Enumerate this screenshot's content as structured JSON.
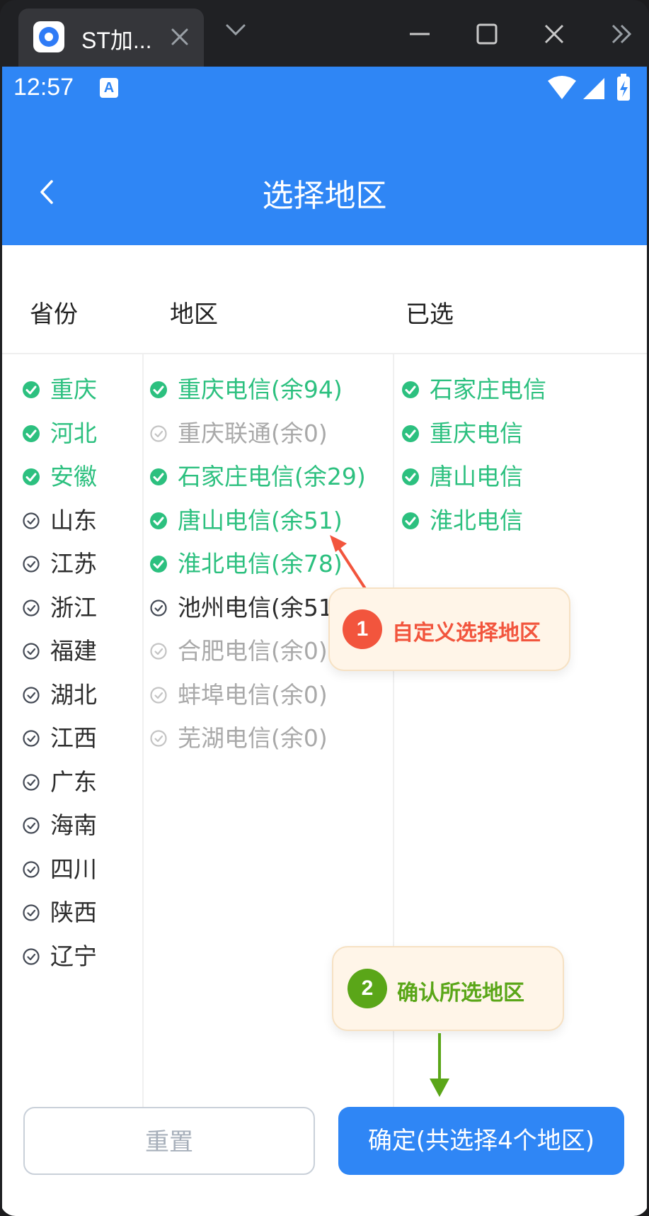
{
  "browser": {
    "tab_title": "ST加...",
    "icons": [
      "app-icon",
      "close-icon",
      "chevron-down-icon",
      "minimize-icon",
      "maximize-icon",
      "close-icon",
      "more-icon"
    ]
  },
  "status_bar": {
    "time": "12:57",
    "indicator": "A"
  },
  "header": {
    "title": "选择地区"
  },
  "columns": {
    "province": "省份",
    "region": "地区",
    "selected": "已选"
  },
  "provinces": [
    {
      "label": "重庆",
      "state": "checked"
    },
    {
      "label": "河北",
      "state": "checked"
    },
    {
      "label": "安徽",
      "state": "checked"
    },
    {
      "label": "山东",
      "state": "available"
    },
    {
      "label": "江苏",
      "state": "available"
    },
    {
      "label": "浙江",
      "state": "available"
    },
    {
      "label": "福建",
      "state": "available"
    },
    {
      "label": "湖北",
      "state": "available"
    },
    {
      "label": "江西",
      "state": "available"
    },
    {
      "label": "广东",
      "state": "available"
    },
    {
      "label": "海南",
      "state": "available"
    },
    {
      "label": "四川",
      "state": "available"
    },
    {
      "label": "陕西",
      "state": "available"
    },
    {
      "label": "辽宁",
      "state": "available"
    }
  ],
  "regions": [
    {
      "label": "重庆电信(余94)",
      "state": "checked"
    },
    {
      "label": "重庆联通(余0)",
      "state": "disabled"
    },
    {
      "label": "石家庄电信(余29)",
      "state": "checked"
    },
    {
      "label": "唐山电信(余51)",
      "state": "checked"
    },
    {
      "label": "淮北电信(余78)",
      "state": "checked"
    },
    {
      "label": "池州电信(余51)",
      "state": "available"
    },
    {
      "label": "合肥电信(余0)",
      "state": "disabled"
    },
    {
      "label": "蚌埠电信(余0)",
      "state": "disabled"
    },
    {
      "label": "芜湖电信(余0)",
      "state": "disabled"
    }
  ],
  "selected": [
    {
      "label": "石家庄电信",
      "state": "checked"
    },
    {
      "label": "重庆电信",
      "state": "checked"
    },
    {
      "label": "唐山电信",
      "state": "checked"
    },
    {
      "label": "淮北电信",
      "state": "checked"
    }
  ],
  "callouts": [
    {
      "number": "1",
      "text": "自定义选择地区",
      "color": "#f2553d"
    },
    {
      "number": "2",
      "text": "确认所选地区",
      "color": "#5aa618"
    }
  ],
  "buttons": {
    "reset": "重置",
    "confirm": "确定(共选择4个地区)"
  },
  "colors": {
    "primary": "#2f86f5",
    "checked": "#2cc07f",
    "disabled": "#a9a9a9",
    "callout_bg": "#fff5e8"
  }
}
